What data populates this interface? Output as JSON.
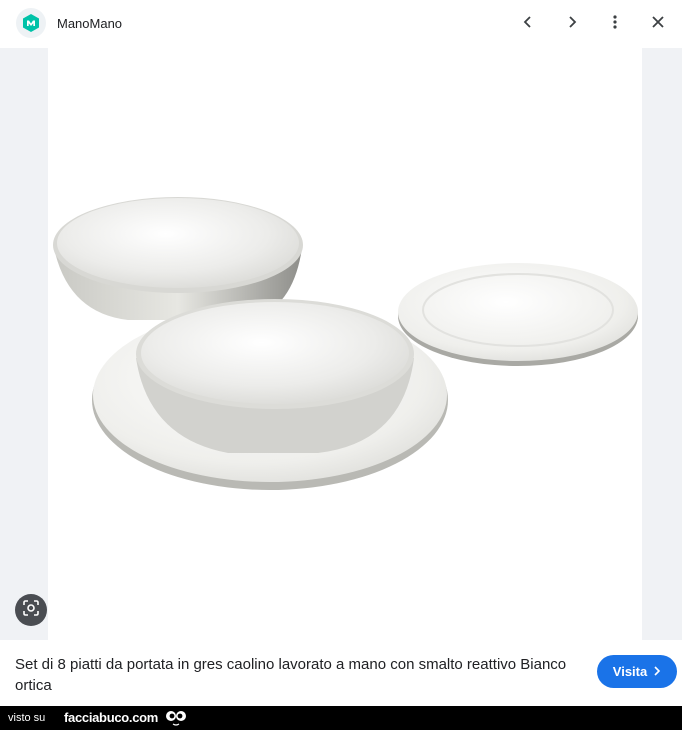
{
  "header": {
    "site_name": "ManoMano",
    "logo_icon": "manomano-logo-icon",
    "actions": [
      "chevron-left-icon",
      "chevron-right-icon",
      "more-vert-icon",
      "close-icon"
    ]
  },
  "viewer": {
    "lens_icon": "lens-icon"
  },
  "product": {
    "title": "Set di 8 piatti da portata in gres caolino lavorato a mano con smalto reattivo Bianco ortica",
    "visit_label": "Visita"
  },
  "credit": {
    "label": "visto su",
    "site": "facciabuco.com"
  },
  "colors": {
    "accent": "#1a73e8",
    "brand": "#00c2a8",
    "viewer_bg": "#f0f2f5"
  }
}
